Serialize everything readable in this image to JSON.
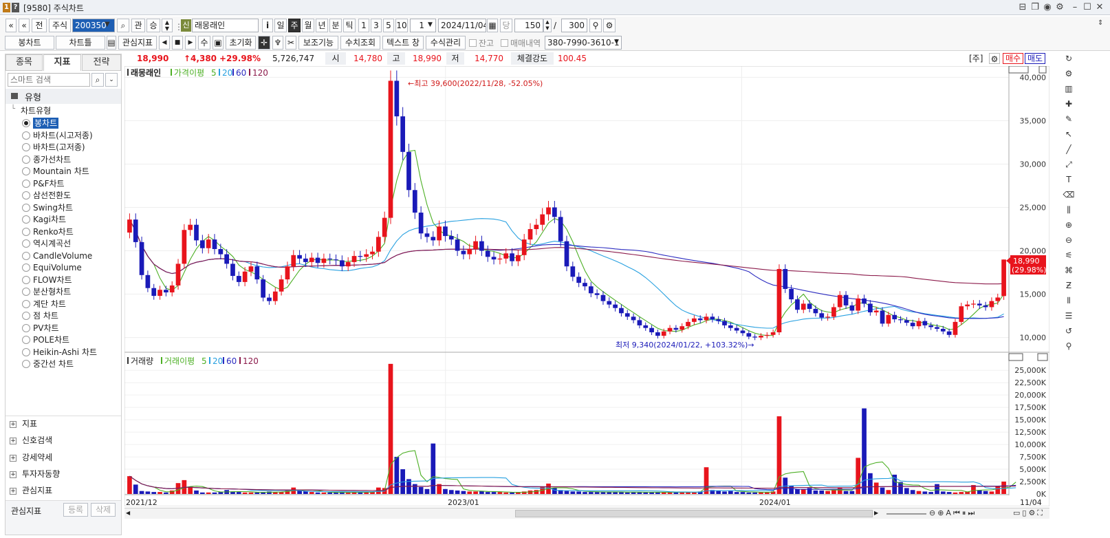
{
  "window": {
    "title": "[9580] 주식차트",
    "badge1": "1",
    "badge2": "?"
  },
  "toolbar1": {
    "prev_label": "«",
    "up_label": "«",
    "jeon": "전",
    "stock_type": "주식",
    "code": "200350",
    "gwan": "관",
    "seung": "승",
    "shin": "신",
    "stock_name": "래몽래인",
    "info": "i",
    "periods": [
      "일",
      "주",
      "월",
      "년",
      "분",
      "틱"
    ],
    "active_period": "주",
    "multipliers": [
      "1",
      "3",
      "5",
      "10"
    ],
    "unit": "1",
    "date": "2024/11/04",
    "dang": "당",
    "count": "150",
    "slash": "/",
    "total": "300"
  },
  "toolbar2": {
    "chart_style": "봉차트",
    "chart_frame": "차트틀",
    "interest": "관심지표",
    "su": "수",
    "reset": "초기화",
    "auxiliary": "보조기능",
    "value_lookup": "수치조회",
    "text_window": "텍스트 창",
    "formula_mgmt": "수식관리",
    "balance": "잔고",
    "trades": "매매내역",
    "account": "380-7990-3610-1"
  },
  "left": {
    "tabs": [
      "종목",
      "지표",
      "전략"
    ],
    "active_tab": "지표",
    "search_placeholder": "스마트 검색",
    "group": "유형",
    "subgroup": "차트유형",
    "chart_types": [
      "봉차트",
      "바차트(시고저종)",
      "바차트(고저종)",
      "종가선차트",
      "Mountain 차트",
      "P&F차트",
      "삼선전환도",
      "Swing차트",
      "Kagi차트",
      "Renko차트",
      "역시계곡선",
      "CandleVolume",
      "EquiVolume",
      "FLOW차트",
      "분산형차트",
      "계단 차트",
      "점 차트",
      "PV차트",
      "POLE차트",
      "Heikin-Ashi 차트",
      "중간선 차트"
    ],
    "selected": "봉차트",
    "sections": [
      "지표",
      "신호검색",
      "강세약세",
      "투자자동향",
      "관심지표"
    ],
    "footer_label": "관심지표",
    "register": "등록",
    "delete": "삭제"
  },
  "pricebar": {
    "price": "18,990",
    "change": "↑4,380",
    "rate": "+29.98%",
    "volume": "5,726,747",
    "open_label": "시",
    "open": "14,780",
    "high_label": "고",
    "high": "18,990",
    "low_label": "저",
    "low": "14,770",
    "strength_label": "체결강도",
    "strength": "100.45",
    "unit_label": "[주]",
    "buy": "매수",
    "sell": "매도"
  },
  "price_legend": {
    "name": "래몽래인",
    "ma_label": "가격이평",
    "p5": "5",
    "p20": "20",
    "p60": "60",
    "p120": "120"
  },
  "volume_legend": {
    "name": "거래량",
    "ma_label": "거래이평",
    "p5": "5",
    "p20": "20",
    "p60": "60",
    "p120": "120"
  },
  "annotations": {
    "high": "←최고 39,600(2022/11/28, -52.05%)",
    "low": "최저 9,340(2024/01/22, +103.32%)→",
    "last_price": "18,990",
    "last_rate": "(29.98%)"
  },
  "colors": {
    "up": "#e8141c",
    "down": "#1a1ab8",
    "ma5": "#4caf24",
    "ma20": "#27a0e0",
    "ma60": "#2b2bc0",
    "ma120": "#8b1a4a",
    "accent": "#1e5fb4"
  },
  "chart_data": {
    "type": "candlestick",
    "x_labels": [
      "2021/12",
      "2023/01",
      "2024/01",
      "11/04"
    ],
    "price_axis": [
      "40,000",
      "35,000",
      "30,000",
      "25,000",
      "20,000",
      "15,000",
      "10,000"
    ],
    "price_range": [
      8300,
      41300
    ],
    "volume_axis": [
      "25,000K",
      "22,500K",
      "20,000K",
      "17,500K",
      "15,000K",
      "12,500K",
      "10,000K",
      "7,500K",
      "5,000K",
      "2,500K",
      "0K"
    ],
    "volume_range": [
      0,
      26700
    ],
    "close": [
      23600,
      21000,
      17200,
      15700,
      14800,
      15500,
      15200,
      16000,
      18500,
      22400,
      23000,
      21200,
      20300,
      21300,
      20200,
      19600,
      18500,
      17100,
      16400,
      17600,
      18200,
      16700,
      14600,
      14200,
      15300,
      16700,
      18200,
      19500,
      19100,
      18700,
      19200,
      18600,
      19100,
      19000,
      18900,
      18200,
      18700,
      19400,
      19300,
      19600,
      19900,
      21600,
      23800,
      39600,
      35500,
      31400,
      27000,
      24400,
      22000,
      21600,
      21200,
      22800,
      21700,
      21300,
      20000,
      19600,
      20200,
      21100,
      20000,
      19300,
      19000,
      19100,
      19700,
      18800,
      19500,
      21300,
      22500,
      23000,
      24200,
      25000,
      23900,
      21100,
      18200,
      17000,
      16300,
      15900,
      15100,
      14900,
      14200,
      13800,
      13400,
      12800,
      12400,
      12000,
      11400,
      11100,
      10600,
      10200,
      10700,
      11100,
      10900,
      11300,
      11800,
      12200,
      12000,
      12400,
      12100,
      11900,
      11400,
      11100,
      10800,
      10500,
      10100,
      10000,
      10200,
      10300,
      10600,
      17900,
      15600,
      14400,
      13200,
      13900,
      13300,
      12800,
      12300,
      12400,
      13500,
      14900,
      13700,
      13100,
      14500,
      13900,
      12900,
      13100,
      11600,
      12600,
      12100,
      12000,
      11700,
      11300,
      11900,
      11400,
      11200,
      11000,
      10700,
      10300,
      11800,
      13600,
      13800,
      13900,
      13700,
      13500,
      14200,
      14610,
      18990
    ],
    "volume": [
      3600,
      1900,
      600,
      500,
      400,
      400,
      300,
      700,
      2200,
      2800,
      1500,
      700,
      300,
      300,
      300,
      400,
      800,
      500,
      400,
      300,
      300,
      300,
      400,
      500,
      400,
      400,
      800,
      1300,
      800,
      600,
      400,
      300,
      300,
      300,
      300,
      400,
      300,
      400,
      300,
      400,
      500,
      1300,
      1200,
      26300,
      7500,
      5000,
      3000,
      2000,
      1400,
      1000,
      10200,
      2000,
      1000,
      800,
      700,
      600,
      500,
      500,
      600,
      400,
      400,
      400,
      300,
      300,
      300,
      500,
      700,
      800,
      1400,
      2100,
      1200,
      800,
      600,
      500,
      500,
      400,
      400,
      400,
      400,
      400,
      400,
      400,
      300,
      400,
      400,
      300,
      400,
      300,
      400,
      400,
      300,
      400,
      300,
      400,
      500,
      5400,
      800,
      700,
      500,
      600,
      400,
      400,
      300,
      300,
      400,
      400,
      500,
      15700,
      3300,
      1600,
      1000,
      1000,
      1200,
      700,
      700,
      600,
      800,
      1300,
      600,
      600,
      7300,
      17300,
      4200,
      2300,
      1300,
      800,
      3900,
      2400,
      1200,
      800,
      600,
      500,
      400,
      2000,
      500,
      400,
      300,
      400,
      500,
      1800,
      800,
      600,
      500,
      1500,
      2500,
      1800,
      5700
    ],
    "last_price": 18990,
    "high_marker": {
      "value": 39600,
      "date": "2022/11/28"
    },
    "low_marker": {
      "value": 9340,
      "date": "2024/01/22"
    }
  }
}
